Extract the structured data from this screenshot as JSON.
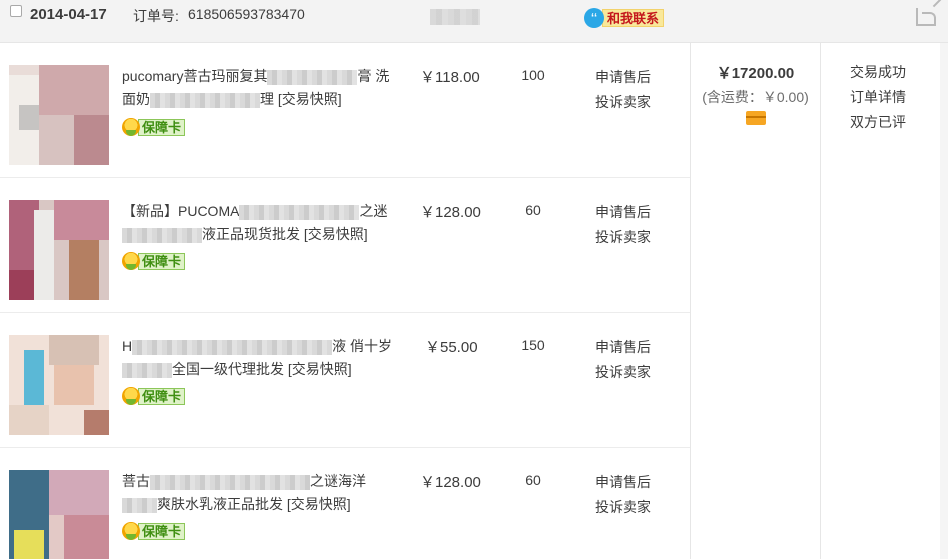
{
  "order": {
    "date": "2014-04-17",
    "order_no_label": "订单号:",
    "order_no": "618506593783470",
    "contact_label": "和我联系",
    "contact_icon": "chat-bubble-icon",
    "share_icon": "share-icon"
  },
  "items": [
    {
      "title_prefix": "pucomary菩古玛丽复其",
      "title_suffix": "膏 洗",
      "title_line2_prefix": "面奶",
      "title_line2_suffix": "理",
      "snapshot": "[交易快照]",
      "badge": "保障卡",
      "price": "￥118.00",
      "qty": "100",
      "action1": "申请售后",
      "action2": "投诉卖家"
    },
    {
      "title_prefix": "【新品】PUCOMA",
      "title_suffix": "之迷",
      "title_line2_prefix": "",
      "title_line2_suffix": "液正品现货批发",
      "snapshot": "[交易快照]",
      "badge": "保障卡",
      "price": "￥128.00",
      "qty": "60",
      "action1": "申请售后",
      "action2": "投诉卖家"
    },
    {
      "title_prefix": "H",
      "title_suffix": "液 俏十岁",
      "title_line2_prefix": "",
      "title_line2_suffix": "全国一级代理批发",
      "snapshot": "[交易快照]",
      "badge": "保障卡",
      "price": "￥55.00",
      "qty": "150",
      "action1": "申请售后",
      "action2": "投诉卖家"
    },
    {
      "title_prefix": "菩古",
      "title_suffix": "之谜海洋",
      "title_line2_prefix": "",
      "title_line2_suffix": "爽肤水乳液正品批发",
      "snapshot": "[交易快照]",
      "badge": "保障卡",
      "price": "￥128.00",
      "qty": "60",
      "action1": "申请售后",
      "action2": "投诉卖家"
    }
  ],
  "summary": {
    "total": "￥17200.00",
    "shipping": "(含运费：￥0.00)",
    "payment_icon": "card-icon"
  },
  "status": {
    "line1": "交易成功",
    "line2": "订单详情",
    "line3": "双方已评"
  }
}
